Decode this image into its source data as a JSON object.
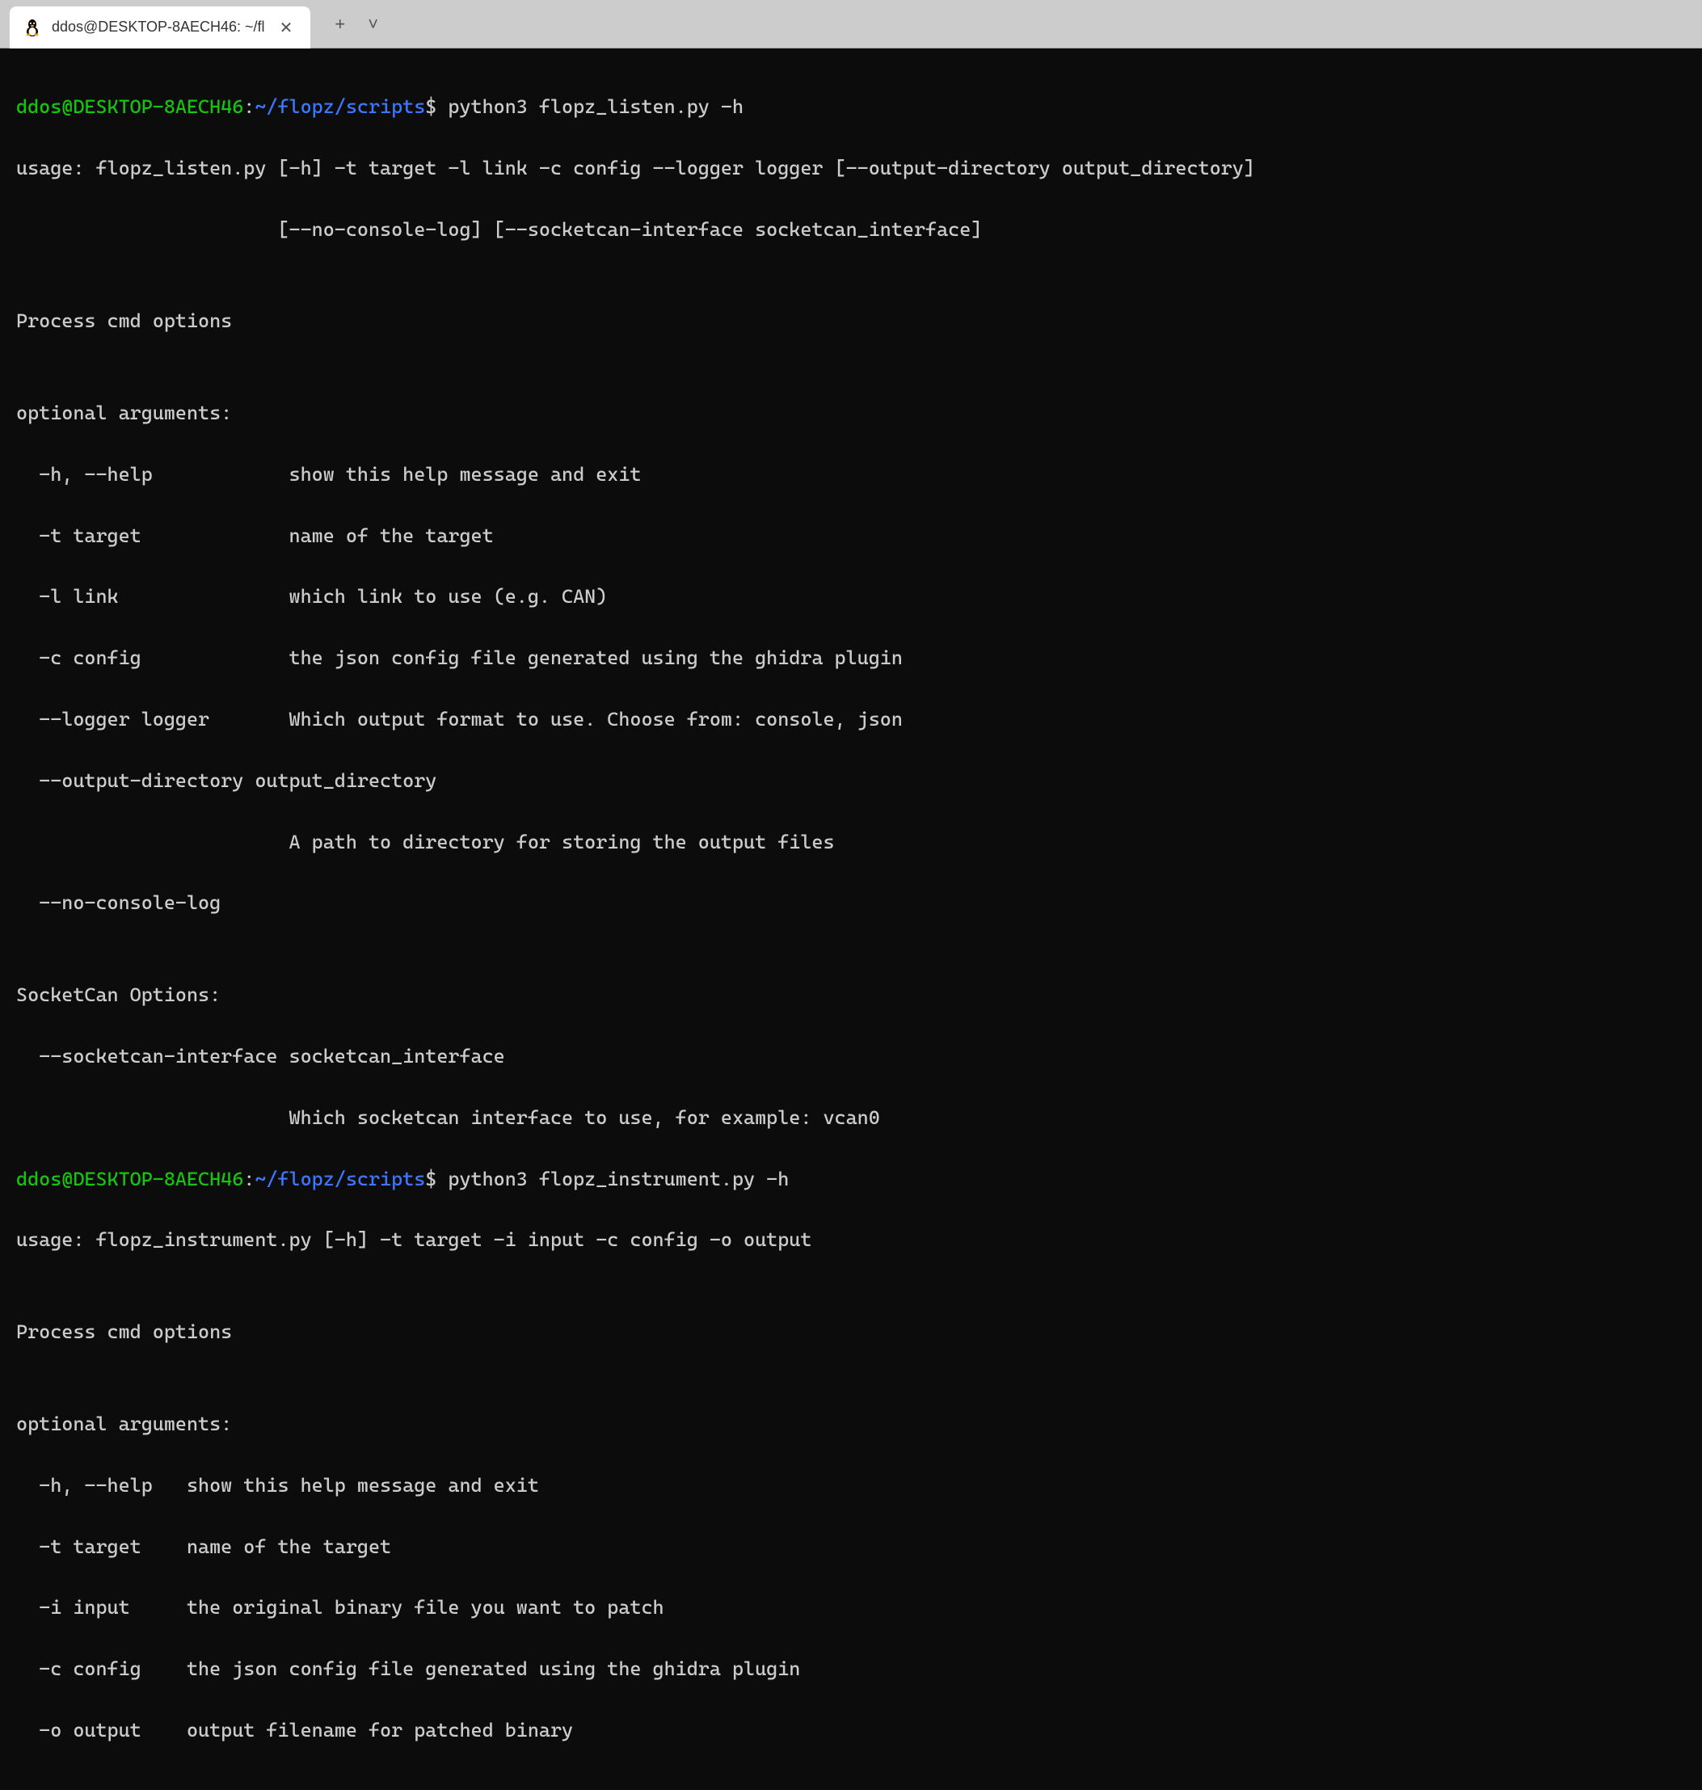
{
  "titlebar": {
    "tab_title": "ddos@DESKTOP-8AECH46: ~/fl",
    "close_symbol": "✕",
    "new_tab_symbol": "+",
    "dropdown_symbol": "˅"
  },
  "prompt1": {
    "user": "ddos@DESKTOP-8AECH46",
    "colon": ":",
    "path": "~/flopz/scripts",
    "dollar": "$",
    "command": " python3 flopz_listen.py -h"
  },
  "output1": {
    "usage1": "usage: flopz_listen.py [-h] -t target -l link -c config --logger logger [--output-directory output_directory]",
    "usage2": "                       [--no-console-log] [--socketcan-interface socketcan_interface]",
    "blank1": "",
    "desc": "Process cmd options",
    "blank2": "",
    "optargs_header": "optional arguments:",
    "arg_h": "  -h, --help            show this help message and exit",
    "arg_t": "  -t target             name of the target",
    "arg_l": "  -l link               which link to use (e.g. CAN)",
    "arg_c": "  -c config             the json config file generated using the ghidra plugin",
    "arg_logger": "  --logger logger       Which output format to use. Choose from: console, json",
    "arg_od1": "  --output-directory output_directory",
    "arg_od2": "                        A path to directory for storing the output files",
    "arg_ncl": "  --no-console-log",
    "blank3": "",
    "sc_header": "SocketCan Options:",
    "sc1": "  --socketcan-interface socketcan_interface",
    "sc2": "                        Which socketcan interface to use, for example: vcan0"
  },
  "prompt2": {
    "user": "ddos@DESKTOP-8AECH46",
    "colon": ":",
    "path": "~/flopz/scripts",
    "dollar": "$",
    "command": " python3 flopz_instrument.py -h"
  },
  "output2": {
    "usage": "usage: flopz_instrument.py [-h] -t target -i input -c config -o output",
    "blank1": "",
    "desc": "Process cmd options",
    "blank2": "",
    "optargs_header": "optional arguments:",
    "arg_h": "  -h, --help   show this help message and exit",
    "arg_t": "  -t target    name of the target",
    "arg_i": "  -i input     the original binary file you want to patch",
    "arg_c": "  -c config    the json config file generated using the ghidra plugin",
    "arg_o": "  -o output    output filename for patched binary"
  }
}
